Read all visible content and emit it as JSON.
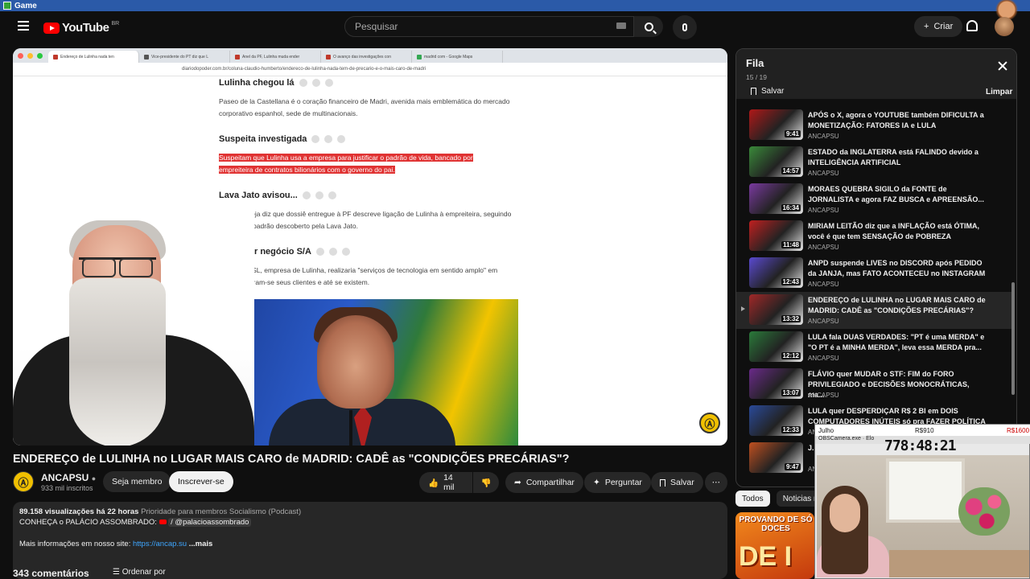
{
  "os_bar": {
    "title": "Game"
  },
  "header": {
    "logo_text": "YouTube",
    "logo_region": "BR",
    "search_placeholder": "Pesquisar",
    "create_label": "Criar"
  },
  "browser": {
    "tabs": [
      {
        "label": "Endereço de Lulinha nada ten",
        "color": "#c0392b"
      },
      {
        "label": "Vice-presidente do PT diz que L",
        "color": "#555555"
      },
      {
        "label": "Anel da PF, Lulinha muda ender",
        "color": "#c0392b"
      },
      {
        "label": "O avanço das investigações con",
        "color": "#c0392b"
      },
      {
        "label": "madrid com - Google Maps",
        "color": "#34a853"
      }
    ],
    "url": "diariodopoder.com.br/coluna-claudio-humberto/endereco-de-lulinha-nada-tem-de-precario-e-o-mais-caro-de-madri"
  },
  "article": {
    "sections": [
      {
        "heading": "Lulinha chegou lá",
        "text": "Paseo de la Castellana é o coração financeiro de Madri, avenida mais emblemática do mercado corporativo espanhol, sede de multinacionais."
      },
      {
        "heading": "Suspeita investigada",
        "text_line1": "Suspeitam que Lulinha usa a empresa para justificar o padrão de vida, bancado por",
        "text_line2": "empreiteira de contratos bilionários com o governo do pai."
      },
      {
        "heading": "Lava Jato avisou...",
        "text": "A revista Veja diz que dossiê entregue à PF descreve ligação de Lulinha à empreiteira, seguindo no mesmo padrão descoberto pela Lava Jato."
      },
      {
        "heading": "Qualquer negócio S/A",
        "text": "A Synapta SL, empresa de Lulinha, realizaria \"serviços de tecnologia em sentido amplo\" em Madri. Ignoram-se seus clientes e até se existem."
      }
    ]
  },
  "video": {
    "title": "ENDEREÇO de LULINHA no LUGAR MAIS CARO de MADRID: CADÊ as \"CONDIÇÕES PRECÁRIAS\"?",
    "channel": "ANCAPSU",
    "subscribers": "933 mil inscritos",
    "member_label": "Seja membro",
    "subscribe_label": "Inscrever-se",
    "likes": "14 mil",
    "share_label": "Compartilhar",
    "ask_label": "Perguntar",
    "save_label": "Salvar",
    "views": "89.158 visualizações",
    "time_ago": "há 22 horas",
    "tags": "Prioridade para membros  Socialismo (Podcast)",
    "desc_line1": "CONHEÇA o PALÁCIO ASSOMBRADO:",
    "desc_handle": "/ @palacioassombrado",
    "desc_line2": "Mais informações em nosso site:",
    "desc_link": "https://ancap.su",
    "more_label": "...mais",
    "comments": "343 comentários",
    "sort_label": "Ordenar por"
  },
  "queue": {
    "title": "Fila",
    "count": "15 / 19",
    "save_label": "Salvar",
    "clear_label": "Limpar",
    "items": [
      {
        "title": "APÓS o X, agora o YOUTUBE também DIFICULTA a MONETIZAÇÃO: FATORES IA e LULA",
        "channel": "ANCAPSU",
        "duration": "9:41",
        "thumb": "#b01818"
      },
      {
        "title": "ESTADO da INGLATERRA está FALINDO devido a INTELIGÊNCIA ARTIFICIAL",
        "channel": "ANCAPSU",
        "duration": "14:57",
        "thumb": "#3a8a3a"
      },
      {
        "title": "MORAES QUEBRA SIGILO da FONTE de JORNALISTA e agora FAZ BUSCA e APREENSÃO...",
        "channel": "ANCAPSU",
        "duration": "16:34",
        "thumb": "#7a3aa0"
      },
      {
        "title": "MIRIAM LEITÃO diz que a INFLAÇÃO está ÓTIMA, você é que tem SENSAÇÃO de POBREZA",
        "channel": "ANCAPSU",
        "duration": "11:48",
        "thumb": "#c02020"
      },
      {
        "title": "ANPD suspende LIVES no DISCORD após PEDIDO da JANJA, mas FATO ACONTECEU no INSTAGRAM",
        "channel": "ANCAPSU",
        "duration": "12:43",
        "thumb": "#5a4ad0"
      },
      {
        "title": "ENDEREÇO de LULINHA no LUGAR MAIS CARO de MADRID: CADÊ as \"CONDIÇÕES PRECÁRIAS\"?",
        "channel": "ANCAPSU",
        "duration": "13:32",
        "thumb": "#a02828"
      },
      {
        "title": "LULA fala DUAS VERDADES: \"PT é uma MERDA\" e \"O PT é a MINHA MERDA\", leva essa MERDA pra...",
        "channel": "ANCAPSU",
        "duration": "12:12",
        "thumb": "#2a7a3a"
      },
      {
        "title": "FLÁVIO quer MUDAR o STF: FIM do FORO PRIVILEGIADO e DECISÕES MONOCRÁTICAS, ma...",
        "channel": "ANCAPSU",
        "duration": "13:07",
        "thumb": "#6a2a8a"
      },
      {
        "title": "LULA quer DESPERDIÇAR R$ 2 BI em DOIS COMPUTADORES INÚTEIS só pra FAZER POLÍTICA",
        "channel": "ANCAPSU",
        "duration": "12:33",
        "thumb": "#2a4a9a"
      },
      {
        "title": "J...",
        "channel": "ANCAPSU",
        "duration": "9:47",
        "thumb": "#c05020"
      }
    ]
  },
  "chips": [
    {
      "label": "Todos"
    },
    {
      "label": "Noticias m"
    }
  ],
  "promo": {
    "text": "PROVANDO DE SÓ DOCES",
    "big": "DE I"
  },
  "webcam": {
    "player_name": "Julho",
    "money1": "R$910",
    "money2": "R$1600",
    "window_title": "OBSCamera.exe",
    "window_sub": "Elo",
    "timer": "778:48:21"
  }
}
